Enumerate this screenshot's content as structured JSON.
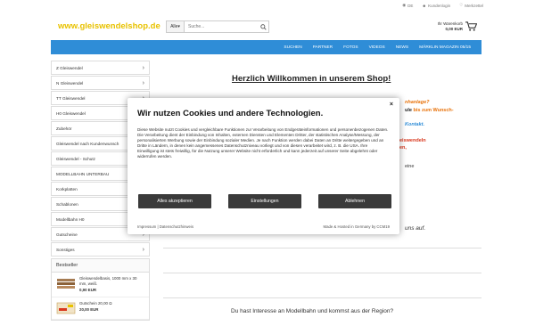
{
  "header": {
    "logo": "www.gleiswendelshop.de",
    "search_dropdown": "Alle",
    "search_placeholder": "Suche...",
    "lang": "DE",
    "login": "Kundenlogin",
    "wishlist": "Merkzettel",
    "cart_label": "Ihr Warenkorb",
    "cart_total": "0,00 EUR"
  },
  "nav": [
    "SUCHEN",
    "PARTNER",
    "FOTOS",
    "VIDEOS",
    "NEWS",
    "MÄRKLIN MAGAZIN 05/15"
  ],
  "sidebar": {
    "categories": [
      {
        "label": "Z Gleiswendel",
        "chevron": true
      },
      {
        "label": "N Gleiswendel",
        "chevron": true
      },
      {
        "label": "TT Gleiswendel",
        "chevron": true
      },
      {
        "label": "H0 Gleiswendel",
        "chevron": true
      },
      {
        "label": "Zubehör",
        "chevron": true
      },
      {
        "label": "Gleiswendel nach Kundenwunsch",
        "chevron": true
      },
      {
        "label": "Gleiswendel - Schutz",
        "chevron": true
      },
      {
        "label": "MODELLBAHN UNTERBAU",
        "chevron": false
      },
      {
        "label": "Korkplatten",
        "chevron": true
      },
      {
        "label": "Schablonen",
        "chevron": true
      },
      {
        "label": "Modellbahn H0",
        "chevron": true
      },
      {
        "label": "Gutscheine",
        "chevron": true
      },
      {
        "label": "Sonstiges",
        "chevron": true
      }
    ]
  },
  "bestseller": {
    "title": "Bestseller",
    "items": [
      {
        "name": "Gleiswendelbasis, 1000 mm x 30 mm, weiß.",
        "price": "0,90 EUR"
      },
      {
        "name": "Gutschein 20,00 Ω",
        "price": "20,00 EUR"
      }
    ]
  },
  "main": {
    "welcome": "Herzlich Willkommen in unserem Shop!",
    "frag1": "nhanlage?",
    "frag2a": "ule ",
    "frag2b": "bis zum Wunsch-",
    "frag3": "Kontakt.",
    "frag4": "eiswendeln",
    "frag5": "en,",
    "frag6": "eine",
    "frag7": "uns auf.",
    "question": "Du hast Interesse an Modellbahn und kommst aus der Region?"
  },
  "cookie": {
    "title": "Wir nutzen Cookies und andere Technologien.",
    "body": "Diese Website nutzt Cookies und vergleichbare Funktionen zur Verarbeitung von Endgeräteinformationen und personenbezogenen Daten. Die Verarbeitung dient der Einbindung von Inhalten, externen Diensten und Elementen Dritter, der statistischen Analyse/Messung, der personalisierten Werbung sowie der Einbindung sozialer Medien. Je nach Funktion werden dabei Daten an Dritte weitergegeben und an Dritte in Ländern, in denen kein angemessenes Datenschutzniveau vorliegt und von diesen verarbeitet wird, z. B. die USA. Ihre Einwilligung ist stets freiwillig, für die Nutzung unserer Website nicht erforderlich und kann jederzeit auf unserer Seite abgelehnt oder widerrufen werden.",
    "close": "×",
    "accept": "Alles akzeptieren",
    "settings": "Einstellungen",
    "decline": "Ablehnen",
    "impressum": "Impressum",
    "separator": "|",
    "privacy": "Datenschutzhinweis",
    "madeby": "Made & Hosted in Germany by CCM19"
  },
  "colors": {
    "brand": "#e8c200",
    "nav": "#2f8dd7",
    "orange": "#e8730c",
    "red": "#d9381e",
    "blue": "#2f8dd7"
  }
}
